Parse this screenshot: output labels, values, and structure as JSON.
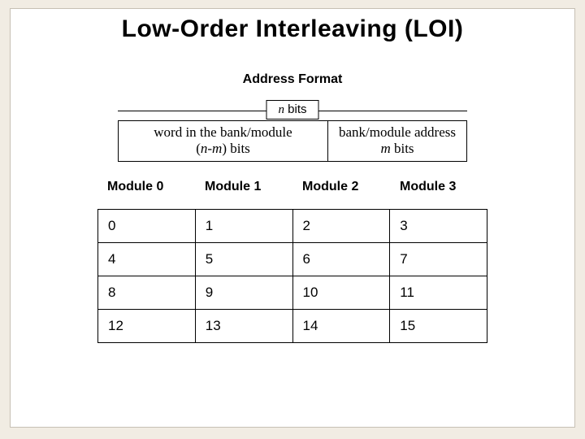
{
  "title": "Low-Order Interleaving (LOI)",
  "address_format_label": "Address Format",
  "nbits": {
    "n": "n",
    "bits": " bits"
  },
  "fields": {
    "left": {
      "line1": "word in the bank/module",
      "line2a": "(",
      "line2b": "n-m",
      "line2c": ") bits"
    },
    "right": {
      "line1": "bank/module address",
      "line2a": "m",
      "line2b": " bits"
    }
  },
  "modules": [
    "Module 0",
    "Module 1",
    "Module 2",
    "Module 3"
  ],
  "grid": [
    [
      "0",
      "1",
      "2",
      "3"
    ],
    [
      "4",
      "5",
      "6",
      "7"
    ],
    [
      "8",
      "9",
      "10",
      "11"
    ],
    [
      "12",
      "13",
      "14",
      "15"
    ]
  ]
}
